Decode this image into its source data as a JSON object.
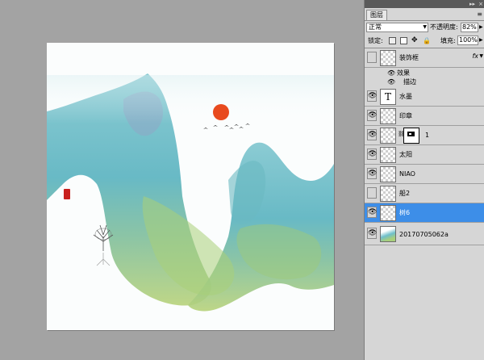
{
  "panel": {
    "tab_label": "图层",
    "menu_glyph": "▸▸",
    "close_glyph": "×",
    "menu_icon": "≡",
    "blend_mode": "正常",
    "opacity_label": "不透明度:",
    "opacity_value": "82%",
    "lock_label": "锁定:",
    "fill_label": "填充:",
    "fill_value": "100%"
  },
  "layers": [
    {
      "name": "装饰框",
      "visible": false,
      "fx": "fx",
      "effects_label": "效果",
      "effect_items": [
        "描边"
      ]
    },
    {
      "name": "水墨",
      "visible": true,
      "thumb": "T"
    },
    {
      "name": "印章",
      "visible": true
    },
    {
      "name": "1",
      "visible": true,
      "mask": true
    },
    {
      "name": "太阳",
      "visible": true
    },
    {
      "name": "NIAO",
      "visible": true
    },
    {
      "name": "船2",
      "visible": false
    },
    {
      "name": "树6",
      "visible": true,
      "selected": true
    },
    {
      "name": "20170705062a",
      "visible": true
    }
  ],
  "colors": {
    "selected": "#3d8ee8",
    "sun": "#e84a1e",
    "seal": "#c8201d",
    "mountain_teal": "#5bb8c4",
    "mountain_green": "#9cc46a"
  },
  "icons": [
    "eye-icon",
    "lock-transparency-icon",
    "lock-paint-icon",
    "lock-move-icon",
    "lock-all-icon",
    "fx-icon",
    "chain-icon"
  ]
}
